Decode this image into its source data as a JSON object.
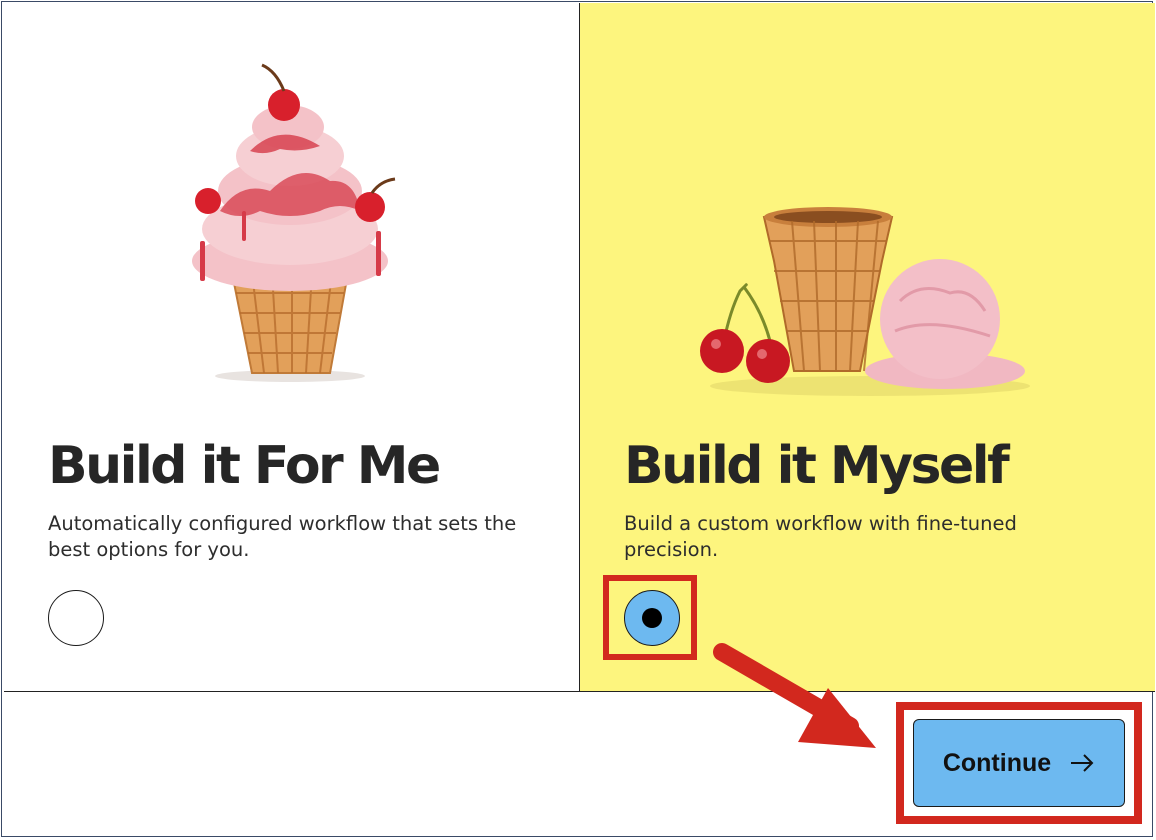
{
  "options": [
    {
      "title": "Build it For Me",
      "description": "Automatically configured workflow that sets the best options for you.",
      "selected": false,
      "illustration": "ice-cream-cone-with-cherries"
    },
    {
      "title": "Build it Myself",
      "description": "Build a custom workflow with fine-tuned precision.",
      "selected": true,
      "illustration": "empty-cone-cherries-and-scoop",
      "background": "#fdf57e"
    }
  ],
  "footer": {
    "continue_label": "Continue",
    "continue_icon": "arrow-right-icon",
    "button_color": "#6db9f0"
  },
  "annotations": {
    "highlight_color": "#d2281e",
    "pointer": "arrow-to-continue-icon"
  }
}
